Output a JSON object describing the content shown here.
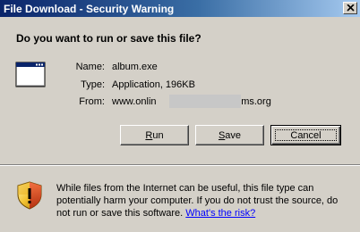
{
  "window": {
    "title": "File Download - Security Warning",
    "close_glyph": "×"
  },
  "question": "Do you want to run or save this file?",
  "file_info": {
    "name_label": "Name:",
    "name_value": "album.exe",
    "type_label": "Type:",
    "type_value": "Application, 196KB",
    "from_label": "From:",
    "from_prefix": "www.onlin",
    "from_suffix": "lbums.org"
  },
  "buttons": {
    "run_mnemonic": "R",
    "run_rest": "un",
    "save_mnemonic": "S",
    "save_rest": "ave",
    "cancel_label": "Cancel"
  },
  "warning": {
    "text": "While files from the Internet can be useful, this file type can potentially harm your computer. If you do not trust the source, do not run or save this software.",
    "link_label": "What's the risk?"
  },
  "icons": {
    "app": "application-window-icon",
    "warning": "security-shield-icon",
    "close": "close-icon"
  }
}
